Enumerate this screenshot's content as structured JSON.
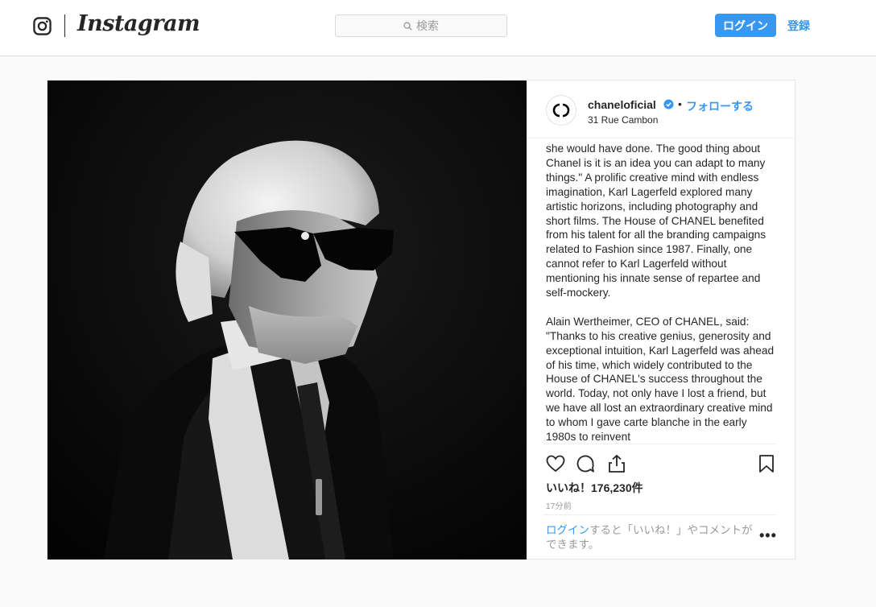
{
  "header": {
    "logo_text": "Instagram",
    "search_placeholder": "検索",
    "login_label": "ログイン",
    "signup_label": "登録"
  },
  "post": {
    "username": "chaneloficial",
    "follow_label": "フォローする",
    "separator": "•",
    "location": "31 Rue Cambon",
    "caption_paragraphs": [
      "she would have done. The good thing about Chanel is it is an idea you can adapt to many things.\" A prolific creative mind with endless imagination, Karl Lagerfeld explored many artistic horizons, including photography and short films. The House of CHANEL benefited from his talent for all the branding campaigns related to Fashion since 1987. Finally, one cannot refer to Karl Lagerfeld without mentioning his innate sense of repartee and self-mockery.",
      "Alain Wertheimer, CEO of CHANEL, said: \"Thanks to his creative genius, generosity and exceptional intuition, Karl Lagerfeld was ahead of his time, which widely contributed to the House of CHANEL's success throughout the world. Today, not only have I lost a friend, but we have all lost an extraordinary creative mind to whom I gave carte blanche in the early 1980s to reinvent"
    ],
    "likes_text": "いいね！176,230件",
    "time_text": "17分前",
    "comment_login_link": "ログイン",
    "comment_prompt_rest": "すると「いいね！」やコメントができます。",
    "more_label": "•••"
  },
  "icons": {
    "instagram": "instagram-icon",
    "search": "search-icon",
    "verified": "verified-badge-icon",
    "like": "heart-icon",
    "comment": "comment-icon",
    "share": "share-icon",
    "save": "bookmark-icon",
    "more": "more-options-icon"
  },
  "colors": {
    "accent": "#3897f0",
    "text": "#262626",
    "muted": "#999999",
    "background": "#fafafa"
  }
}
